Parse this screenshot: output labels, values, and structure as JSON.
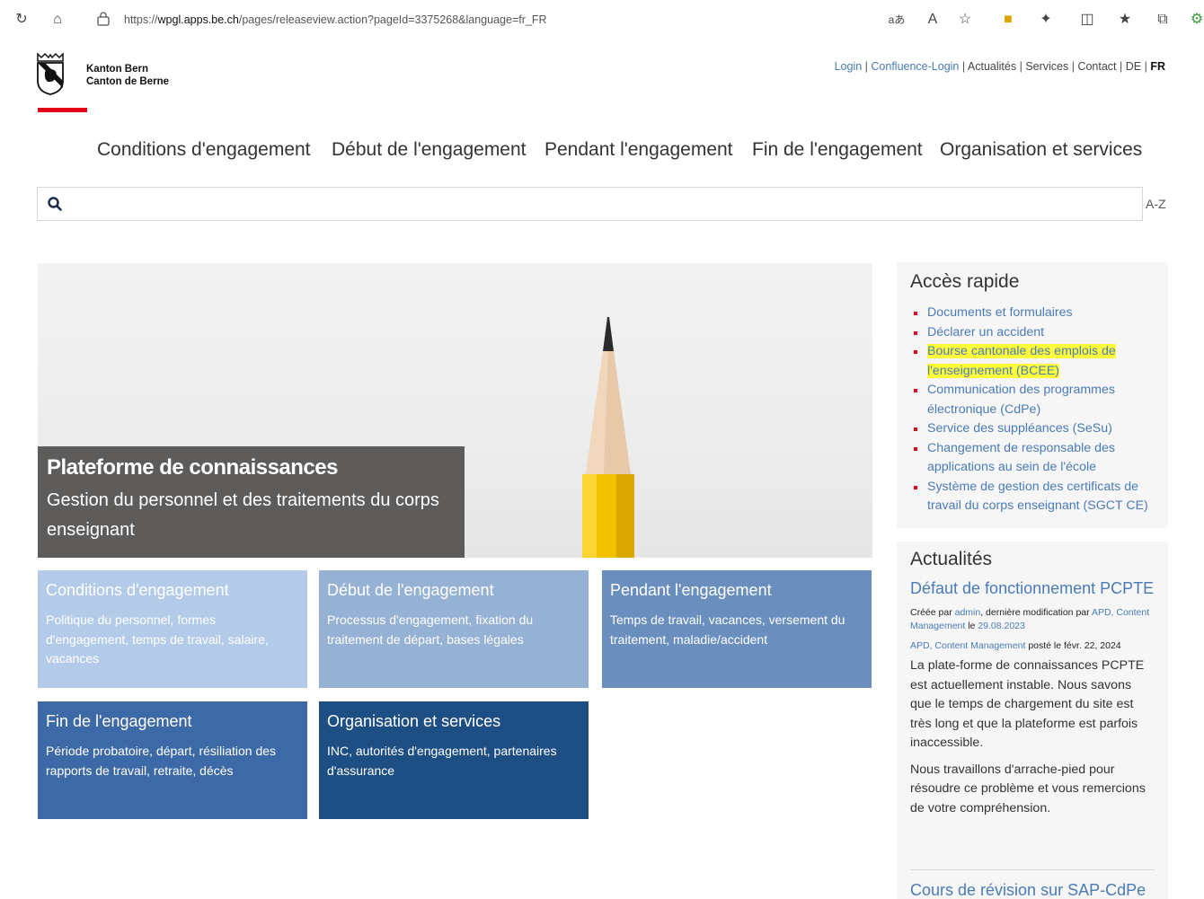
{
  "browser": {
    "url_prefix": "https://",
    "url_host": "wpgl.apps.be.ch",
    "url_path": "/pages/releaseview.action?pageId=3375268&language=fr_FR",
    "read_aloud_label": "aあ"
  },
  "header": {
    "brand_line1": "Kanton Bern",
    "brand_line2": "Canton de Berne",
    "links": {
      "login": "Login",
      "confluence_login": "Confluence-Login",
      "actualites": "Actualités",
      "services": "Services",
      "contact": "Contact",
      "de": "DE",
      "fr": "FR",
      "sep": " | "
    }
  },
  "nav": [
    "Conditions d'engagement",
    "Début de l'engagement",
    "Pendant l'engagement",
    "Fin de l'engagement",
    "Organisation et services"
  ],
  "search": {
    "placeholder": "",
    "az_label": "A-Z"
  },
  "hero": {
    "title": "Plateforme de connaissances",
    "subtitle": "Gestion du personnel et des traitements du corps enseignant"
  },
  "tiles": [
    {
      "title": "Conditions d'engagement",
      "desc": "Politique du personnel, formes d'engagement, temps de travail, salaire, vacances"
    },
    {
      "title": "Début de l'engagement",
      "desc": "Processus d'engagement, fixation du traitement de départ, bases légales"
    },
    {
      "title": "Pendant l'engagement",
      "desc": "Temps de travail, vacances, versement du traitement, maladie/accident"
    },
    {
      "title": "Fin de l'engagement",
      "desc": "Période probatoire, départ, résiliation des rapports de travail, retraite, décès"
    },
    {
      "title": "Organisation et services",
      "desc": "INC, autorités d'engagement, partenaires d'assurance"
    }
  ],
  "quick_access": {
    "title": "Accès rapide",
    "items": [
      "Documents et formulaires",
      "Déclarer un accident",
      "Bourse cantonale des emplois de l'enseignement (BCEE)",
      "Communication des programmes électronique (CdPe)",
      "Service des suppléances (SeSu)",
      "Changement de responsable des applications au sein de l'école",
      "Système de gestion des certificats de travail du corps enseignant (SGCT CE)"
    ],
    "highlight_color": "#ffff3a"
  },
  "news": {
    "title": "Actualités",
    "headline": "Défaut de fonctionnement PCPTE",
    "meta_created": "Créée par ",
    "meta_admin": "admin",
    "meta_modified": ", dernière modification par ",
    "meta_author": "APD, Content Management",
    "meta_on": " le ",
    "meta_date": "29.08.2023",
    "meta2_author": "APD, Content Management",
    "meta2_posted": " posté le févr. 22, 2024",
    "body1": "La plate-forme de connaissances PCPTE est actuellement instable. Nous savons que le temps de chargement du site est très long et que la plateforme est parfois inaccessible.",
    "body2": "Nous travaillons d'arrache-pied pour résoudre ce problème et vous remercions de votre compréhension.",
    "next_headline": "Cours de révision sur SAP-CdPe"
  },
  "colors": {
    "accent_red": "#e3001b",
    "link_blue": "#4a7bb7",
    "tile1": "#b3cbe8",
    "tile2": "#95b1d4",
    "tile3": "#6a8fbf",
    "tile4": "#3d6aa6",
    "tile5": "#1d4e84"
  }
}
